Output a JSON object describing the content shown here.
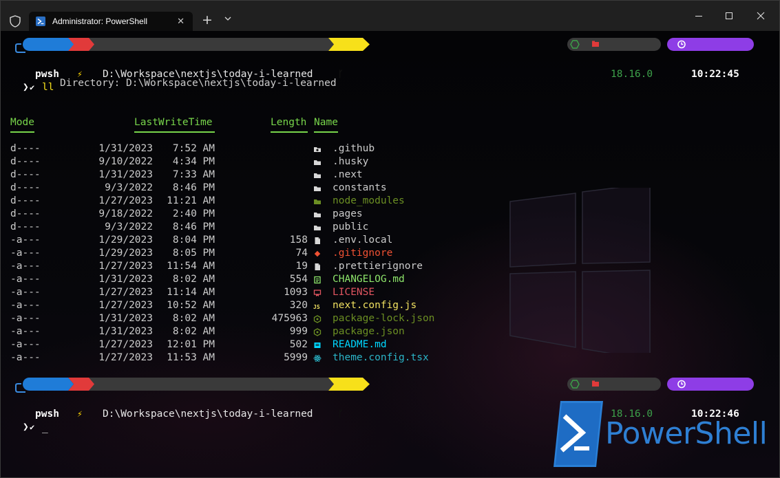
{
  "window": {
    "tab_title": "Administrator: PowerShell",
    "tab_close": "✕",
    "new_tab": "+"
  },
  "colors": {
    "prompt_blue": "#1f7cd8",
    "prompt_red": "#e13a3a",
    "path_bg": "#3a3a3a",
    "git_yellow": "#f7e01a",
    "node_green": "#3ca14a",
    "time_purple": "#8e3de6"
  },
  "prompts": [
    {
      "shell": "pwsh",
      "admin_icon": "⚡",
      "path": "D:\\Workspace\\nextjs\\today-i-learned",
      "git_icon": "ᚴ",
      "node_version": "18.16.0",
      "time": "10:22:45",
      "arrow": "❯",
      "check": "✔",
      "command": "ll"
    },
    {
      "shell": "pwsh",
      "admin_icon": "⚡",
      "path": "D:\\Workspace\\nextjs\\today-i-learned",
      "git_icon": "ᚴ",
      "node_version": "18.16.0",
      "time": "10:22:46",
      "arrow": "❯",
      "check": "✔",
      "command": "_"
    }
  ],
  "listing": {
    "directory_label": "Directory: D:\\Workspace\\nextjs\\today-i-learned",
    "headers": {
      "mode": "Mode",
      "lastwritetime": "LastWriteTime",
      "length": "Length",
      "name": "Name"
    },
    "rows": [
      {
        "mode": "d----",
        "date": "1/31/2023",
        "time": "7:52 AM",
        "length": "",
        "name": ".github",
        "icon": "github-folder-icon",
        "color": "#cccccc"
      },
      {
        "mode": "d----",
        "date": "9/10/2022",
        "time": "4:34 PM",
        "length": "",
        "name": ".husky",
        "icon": "folder-icon",
        "color": "#cccccc"
      },
      {
        "mode": "d----",
        "date": "1/31/2023",
        "time": "7:33 AM",
        "length": "",
        "name": ".next",
        "icon": "folder-icon",
        "color": "#cccccc"
      },
      {
        "mode": "d----",
        "date": "9/3/2022",
        "time": "8:46 PM",
        "length": "",
        "name": "constants",
        "icon": "folder-icon",
        "color": "#cccccc"
      },
      {
        "mode": "d----",
        "date": "1/27/2023",
        "time": "11:21 AM",
        "length": "",
        "name": "node_modules",
        "icon": "node-folder-icon",
        "color": "#6b8e23"
      },
      {
        "mode": "d----",
        "date": "9/18/2022",
        "time": "2:40 PM",
        "length": "",
        "name": "pages",
        "icon": "folder-icon",
        "color": "#cccccc"
      },
      {
        "mode": "d----",
        "date": "9/3/2022",
        "time": "8:46 PM",
        "length": "",
        "name": "public",
        "icon": "folder-icon",
        "color": "#cccccc"
      },
      {
        "mode": "-a---",
        "date": "1/29/2023",
        "time": "8:04 PM",
        "length": "158",
        "name": ".env.local",
        "icon": "file-icon",
        "color": "#cccccc"
      },
      {
        "mode": "-a---",
        "date": "1/29/2023",
        "time": "8:05 PM",
        "length": "74",
        "name": ".gitignore",
        "icon": "git-icon",
        "color": "#f05133"
      },
      {
        "mode": "-a---",
        "date": "1/27/2023",
        "time": "11:54 AM",
        "length": "19",
        "name": ".prettierignore",
        "icon": "file-icon",
        "color": "#cccccc"
      },
      {
        "mode": "-a---",
        "date": "1/31/2023",
        "time": "8:02 AM",
        "length": "554",
        "name": "CHANGELOG.md",
        "icon": "changelog-icon",
        "color": "#8ee66b"
      },
      {
        "mode": "-a---",
        "date": "1/27/2023",
        "time": "11:14 AM",
        "length": "1093",
        "name": "LICENSE",
        "icon": "license-icon",
        "color": "#e05560"
      },
      {
        "mode": "-a---",
        "date": "1/27/2023",
        "time": "10:52 AM",
        "length": "320",
        "name": "next.config.js",
        "icon": "js-icon",
        "color": "#f0e060"
      },
      {
        "mode": "-a---",
        "date": "1/31/2023",
        "time": "8:02 AM",
        "length": "475963",
        "name": "package-lock.json",
        "icon": "npm-icon",
        "color": "#6b8e23"
      },
      {
        "mode": "-a---",
        "date": "1/31/2023",
        "time": "8:02 AM",
        "length": "999",
        "name": "package.json",
        "icon": "npm-icon",
        "color": "#6b8e23"
      },
      {
        "mode": "-a---",
        "date": "1/27/2023",
        "time": "12:01 PM",
        "length": "502",
        "name": "README.md",
        "icon": "readme-icon",
        "color": "#00d7ff"
      },
      {
        "mode": "-a---",
        "date": "1/27/2023",
        "time": "11:53 AM",
        "length": "5999",
        "name": "theme.config.tsx",
        "icon": "react-icon",
        "color": "#2bb5c8"
      }
    ]
  },
  "branding": {
    "logo_text": "PowerShell"
  }
}
